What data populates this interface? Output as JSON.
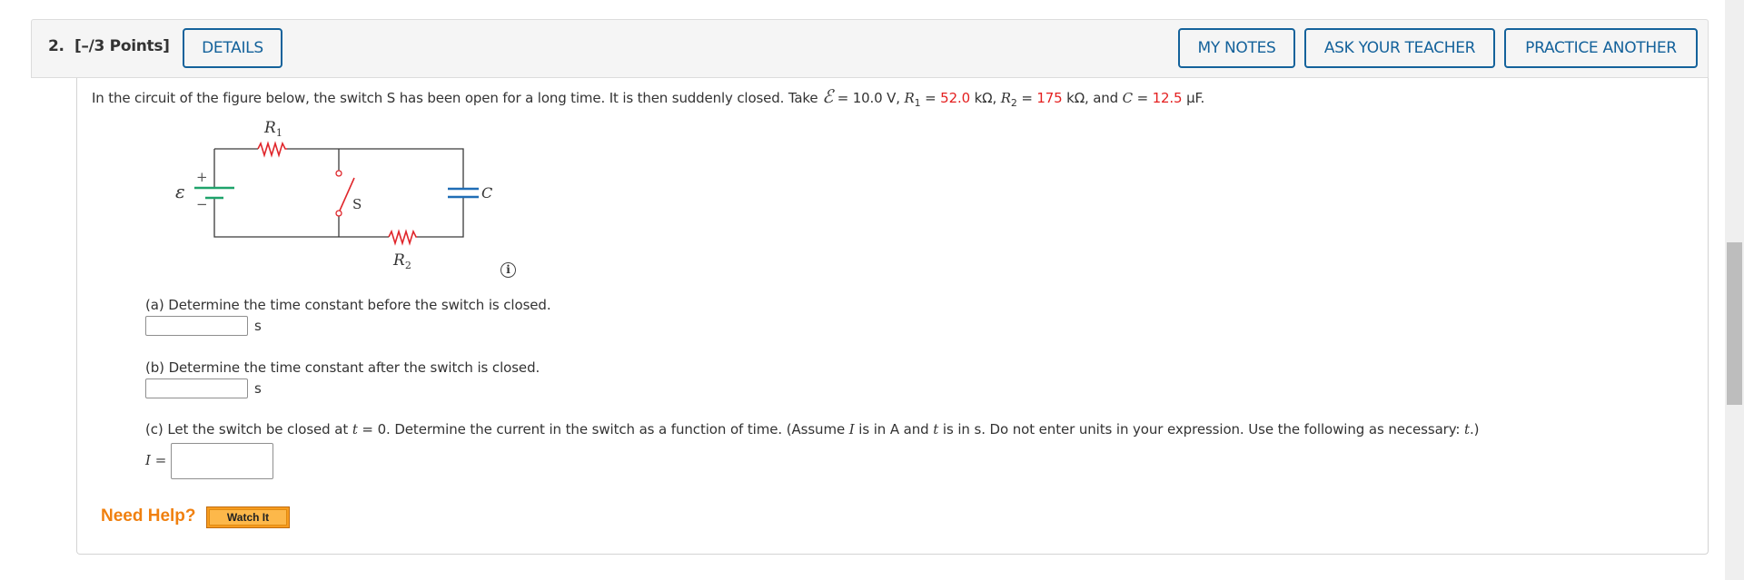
{
  "header": {
    "question_number": "2.",
    "points": "[–/3 Points]",
    "buttons": {
      "details": "DETAILS",
      "my_notes": "MY NOTES",
      "ask_teacher": "ASK YOUR TEACHER",
      "practice_another": "PRACTICE ANOTHER"
    },
    "accent_color": "#14629b"
  },
  "problem": {
    "intro": "In the circuit of the figure below, the switch S has been open for a long time. It is then suddenly closed. Take ",
    "emf_symbol": "ℰ",
    "emf_value": " = 10.0 V, ",
    "r1_symbol": "R",
    "r1_sub": "1",
    "r1_eq": " = ",
    "r1_value": "52.0",
    "r1_unit": " kΩ, ",
    "r2_symbol": "R",
    "r2_sub": "2",
    "r2_eq": " = ",
    "r2_value": "175",
    "r2_unit": " kΩ, and ",
    "c_symbol": "C",
    "c_eq": " = ",
    "c_value": "12.5",
    "c_unit": " μF.",
    "highlight_color": "#e41f1f"
  },
  "figure": {
    "labels": {
      "r1": "R",
      "r1_sub": "1",
      "r2": "R",
      "r2_sub": "2",
      "emf": "ε",
      "plus": "+",
      "minus": "−",
      "switch": "S",
      "capacitor": "C"
    },
    "colors": {
      "wire": "#3a3a3a",
      "resistor": "#e0262b",
      "battery": "#1fa36b",
      "capacitor": "#1f6db5",
      "switch": "#e0262b"
    },
    "info_icon": "i"
  },
  "parts": [
    {
      "label": "(a) Determine the time constant before the switch is closed.",
      "unit": "s",
      "value": ""
    },
    {
      "label": "(b) Determine the time constant after the switch is closed.",
      "unit": "s",
      "value": ""
    },
    {
      "label_pre": "(c) Let the switch be closed at ",
      "t1": "t",
      "label_mid1": " = 0. Determine the current in the switch as a function of time. (Assume ",
      "I": "I",
      "label_mid2": " is in A and ",
      "t2": "t",
      "label_mid3": " is in s. Do not enter units in your expression. Use the following as necessary: ",
      "t3": "t",
      "label_end": ".)",
      "var_label": "I =",
      "value": ""
    }
  ],
  "help": {
    "need_help": "Need Help?",
    "watch_it": "Watch It"
  }
}
